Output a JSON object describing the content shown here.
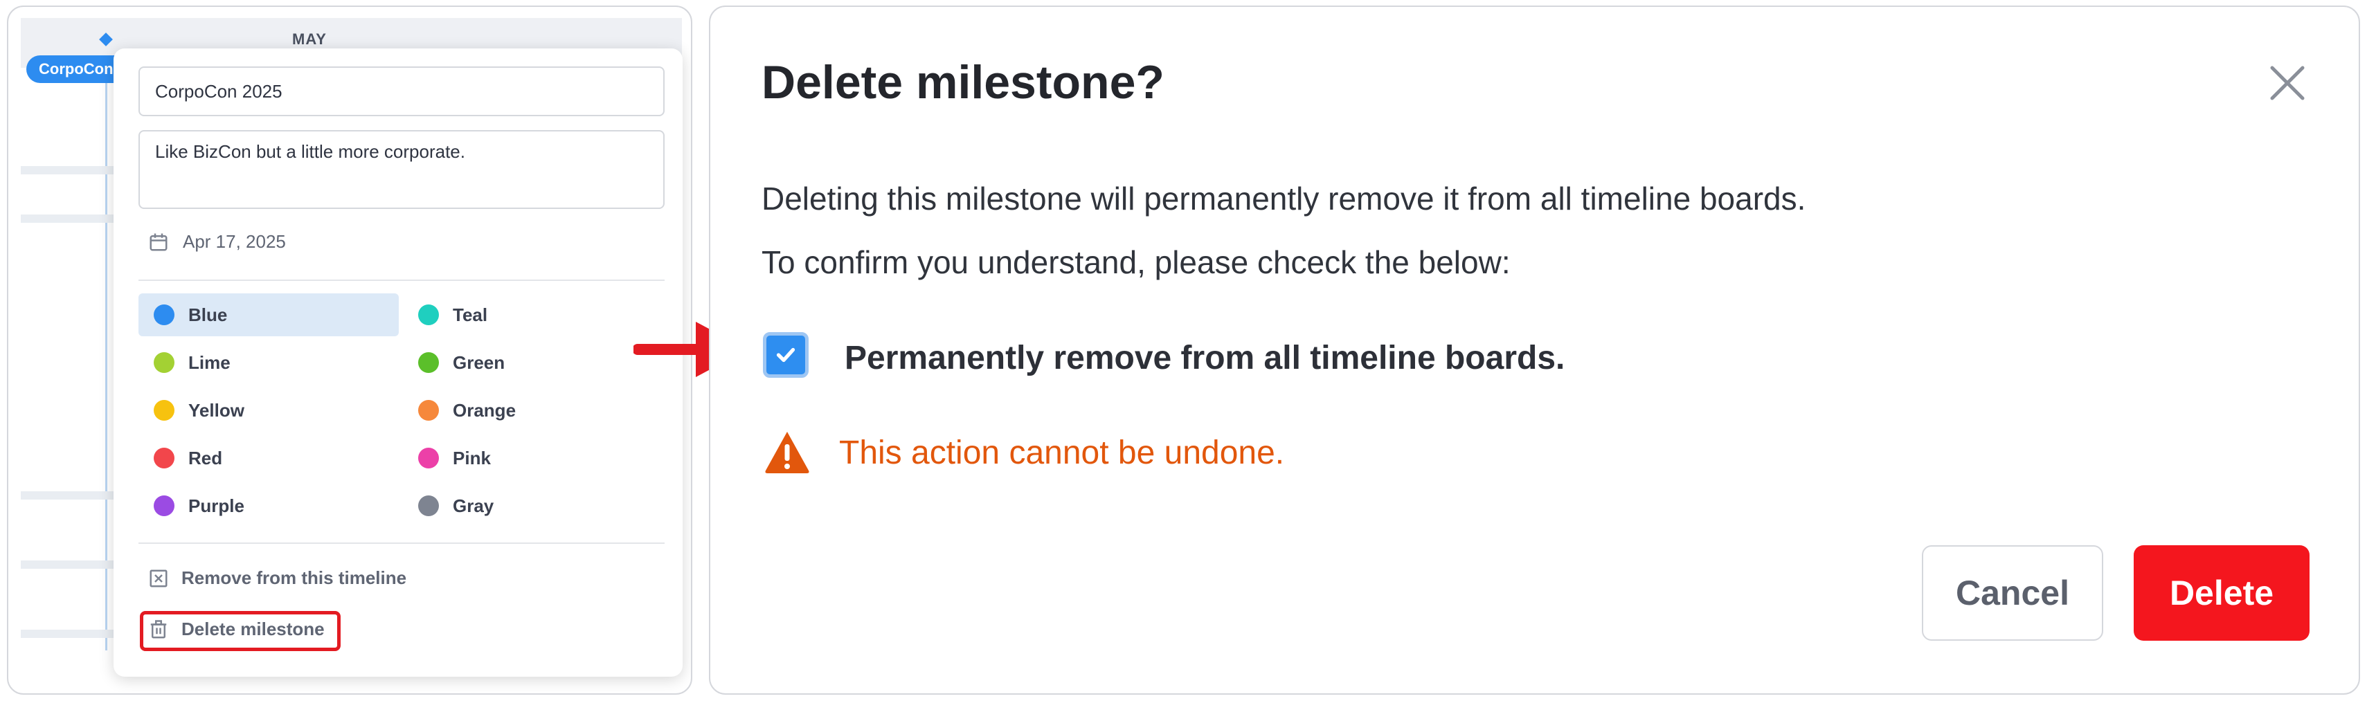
{
  "timeline": {
    "month_label": "MAY",
    "milestone_chip": "CorpoCon 2025"
  },
  "popover": {
    "title_value": "CorpoCon 2025",
    "description_value": "Like BizCon but a little more corporate.",
    "date": "Apr 17, 2025",
    "colors": [
      {
        "label": "Blue",
        "hex": "#2d8cf0",
        "selected": true
      },
      {
        "label": "Teal",
        "hex": "#1fcfbf",
        "selected": false
      },
      {
        "label": "Lime",
        "hex": "#a3d133",
        "selected": false
      },
      {
        "label": "Green",
        "hex": "#5bbf2a",
        "selected": false
      },
      {
        "label": "Yellow",
        "hex": "#f7c20f",
        "selected": false
      },
      {
        "label": "Orange",
        "hex": "#f6883b",
        "selected": false
      },
      {
        "label": "Red",
        "hex": "#f2464b",
        "selected": false
      },
      {
        "label": "Pink",
        "hex": "#ec40a8",
        "selected": false
      },
      {
        "label": "Purple",
        "hex": "#9b4be3",
        "selected": false
      },
      {
        "label": "Gray",
        "hex": "#7e8491",
        "selected": false
      }
    ],
    "remove_label": "Remove from this timeline",
    "delete_label": "Delete milestone"
  },
  "dialog": {
    "title": "Delete milestone?",
    "line1": "Deleting this milestone will permanently remove it from all timeline boards.",
    "line2": "To confirm you understand, please chceck the below:",
    "checkbox_label": "Permanently remove from all timeline boards.",
    "checkbox_checked": true,
    "warning": "This action cannot be undone.",
    "cancel_label": "Cancel",
    "delete_label": "Delete"
  }
}
